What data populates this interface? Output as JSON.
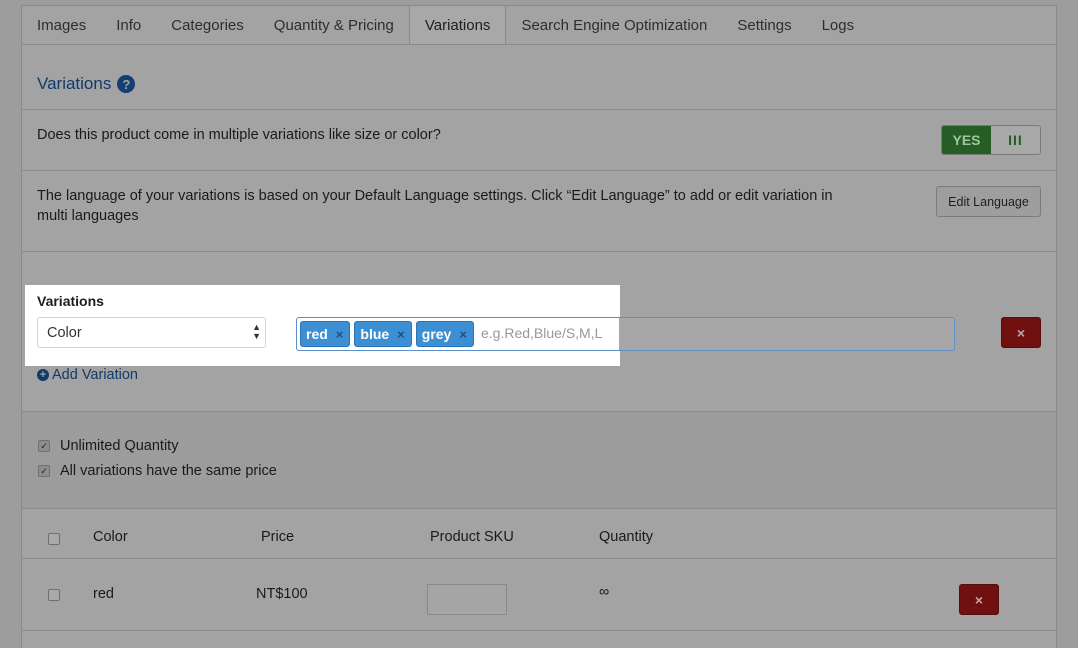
{
  "tabs": [
    {
      "label": "Images",
      "active": false
    },
    {
      "label": "Info",
      "active": false
    },
    {
      "label": "Categories",
      "active": false
    },
    {
      "label": "Quantity & Pricing",
      "active": false
    },
    {
      "label": "Variations",
      "active": true
    },
    {
      "label": "Search Engine Optimization",
      "active": false
    },
    {
      "label": "Settings",
      "active": false
    },
    {
      "label": "Logs",
      "active": false
    }
  ],
  "section": {
    "title": "Variations",
    "help_icon": "?"
  },
  "multi_variation": {
    "question": "Does this product come in multiple variations like size or color?",
    "toggle_yes": "YES",
    "toggle_no": "III"
  },
  "language": {
    "text": "The language of your variations is based on your Default Language settings. Click “Edit Language” to add or edit variation in multi languages",
    "button": "Edit Language"
  },
  "variations": {
    "label": "Variations",
    "selected_type": "Color",
    "tags": [
      "red",
      "blue",
      "grey"
    ],
    "tag_remove": "×",
    "placeholder": "e.g.Red,Blue/S,M,L",
    "remove_button": "×",
    "add_label": "Add Variation"
  },
  "options": {
    "unlimited_quantity": "Unlimited Quantity",
    "same_price": "All variations have the same price",
    "check_mark": "✓"
  },
  "table": {
    "headers": [
      "Color",
      "Price",
      "Product SKU",
      "Quantity"
    ],
    "rows": [
      {
        "color": "red",
        "price": "NT$100",
        "sku": "",
        "quantity": "∞",
        "remove": "×"
      }
    ]
  },
  "colors": {
    "accent": "#3d8fd4",
    "danger": "#701010",
    "success": "#255d25"
  }
}
